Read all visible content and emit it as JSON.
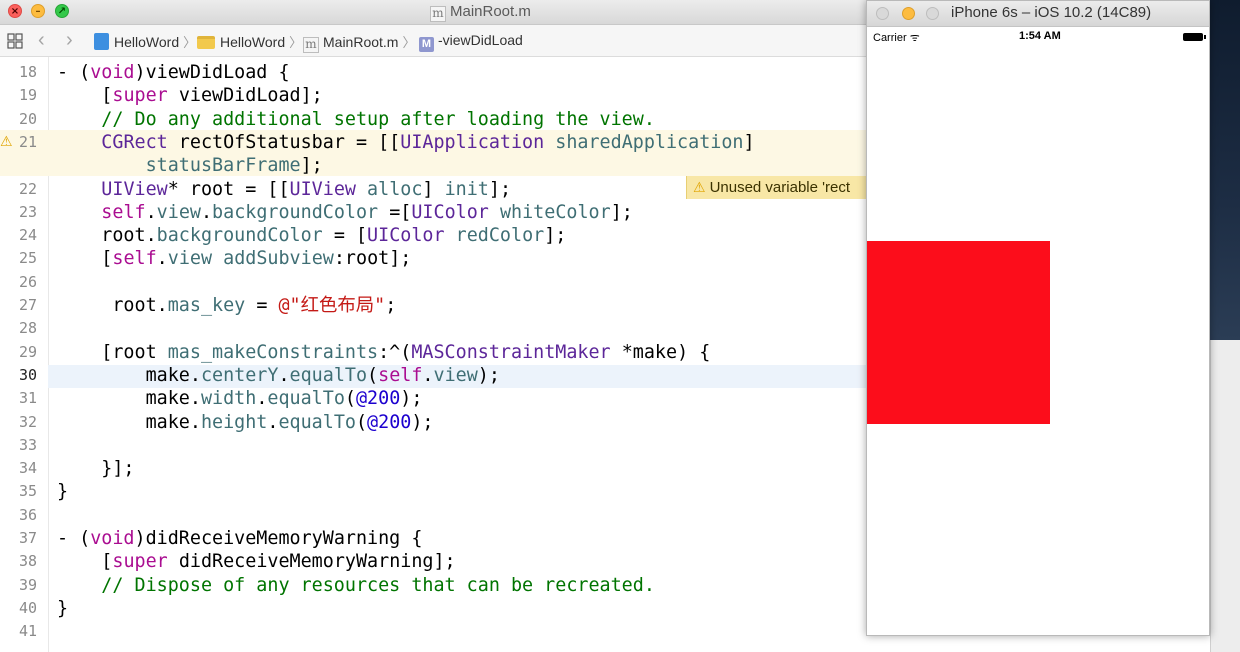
{
  "xcode": {
    "window_title": "MainRoot.m",
    "breadcrumb": {
      "project": "HelloWord",
      "folder": "HelloWord",
      "file": "MainRoot.m",
      "method": "-viewDidLoad"
    },
    "warning_text": "Unused variable 'rect"
  },
  "code_lines": [
    {
      "n": "18",
      "t": "- (void)viewDidLoad {"
    },
    {
      "n": "19",
      "t": "    [super viewDidLoad];"
    },
    {
      "n": "20",
      "t": "    // Do any additional setup after loading the view."
    },
    {
      "n": "21",
      "t": "    CGRect rectOfStatusbar = [[UIApplication sharedApplication]"
    },
    {
      "n": "",
      "t": "        statusBarFrame];"
    },
    {
      "n": "22",
      "t": "    UIView* root = [[UIView alloc] init];"
    },
    {
      "n": "23",
      "t": "    self.view.backgroundColor =[UIColor whiteColor];"
    },
    {
      "n": "24",
      "t": "    root.backgroundColor = [UIColor redColor];"
    },
    {
      "n": "25",
      "t": "    [self.view addSubview:root];"
    },
    {
      "n": "26",
      "t": ""
    },
    {
      "n": "27",
      "t": "     root.mas_key = @\"红色布局\";"
    },
    {
      "n": "28",
      "t": ""
    },
    {
      "n": "29",
      "t": "    [root mas_makeConstraints:^(MASConstraintMaker *make) {"
    },
    {
      "n": "30",
      "t": "        make.centerY.equalTo(self.view);"
    },
    {
      "n": "31",
      "t": "        make.width.equalTo(@200);"
    },
    {
      "n": "32",
      "t": "        make.height.equalTo(@200);"
    },
    {
      "n": "33",
      "t": ""
    },
    {
      "n": "34",
      "t": "    }];"
    },
    {
      "n": "35",
      "t": "}"
    },
    {
      "n": "36",
      "t": ""
    },
    {
      "n": "37",
      "t": "- (void)didReceiveMemoryWarning {"
    },
    {
      "n": "38",
      "t": "    [super didReceiveMemoryWarning];"
    },
    {
      "n": "39",
      "t": "    // Dispose of any resources that can be recreated."
    },
    {
      "n": "40",
      "t": "}"
    },
    {
      "n": "41",
      "t": ""
    }
  ],
  "simulator": {
    "title": "iPhone 6s – iOS 10.2 (14C89)",
    "carrier": "Carrier",
    "time": "1:54 AM",
    "red_view_color": "#fc0d1b"
  },
  "colors": {
    "keyword": "#aa0d91",
    "class": "#5c2699",
    "comment": "#007400",
    "string": "#c41a16",
    "number": "#1c00cf"
  }
}
